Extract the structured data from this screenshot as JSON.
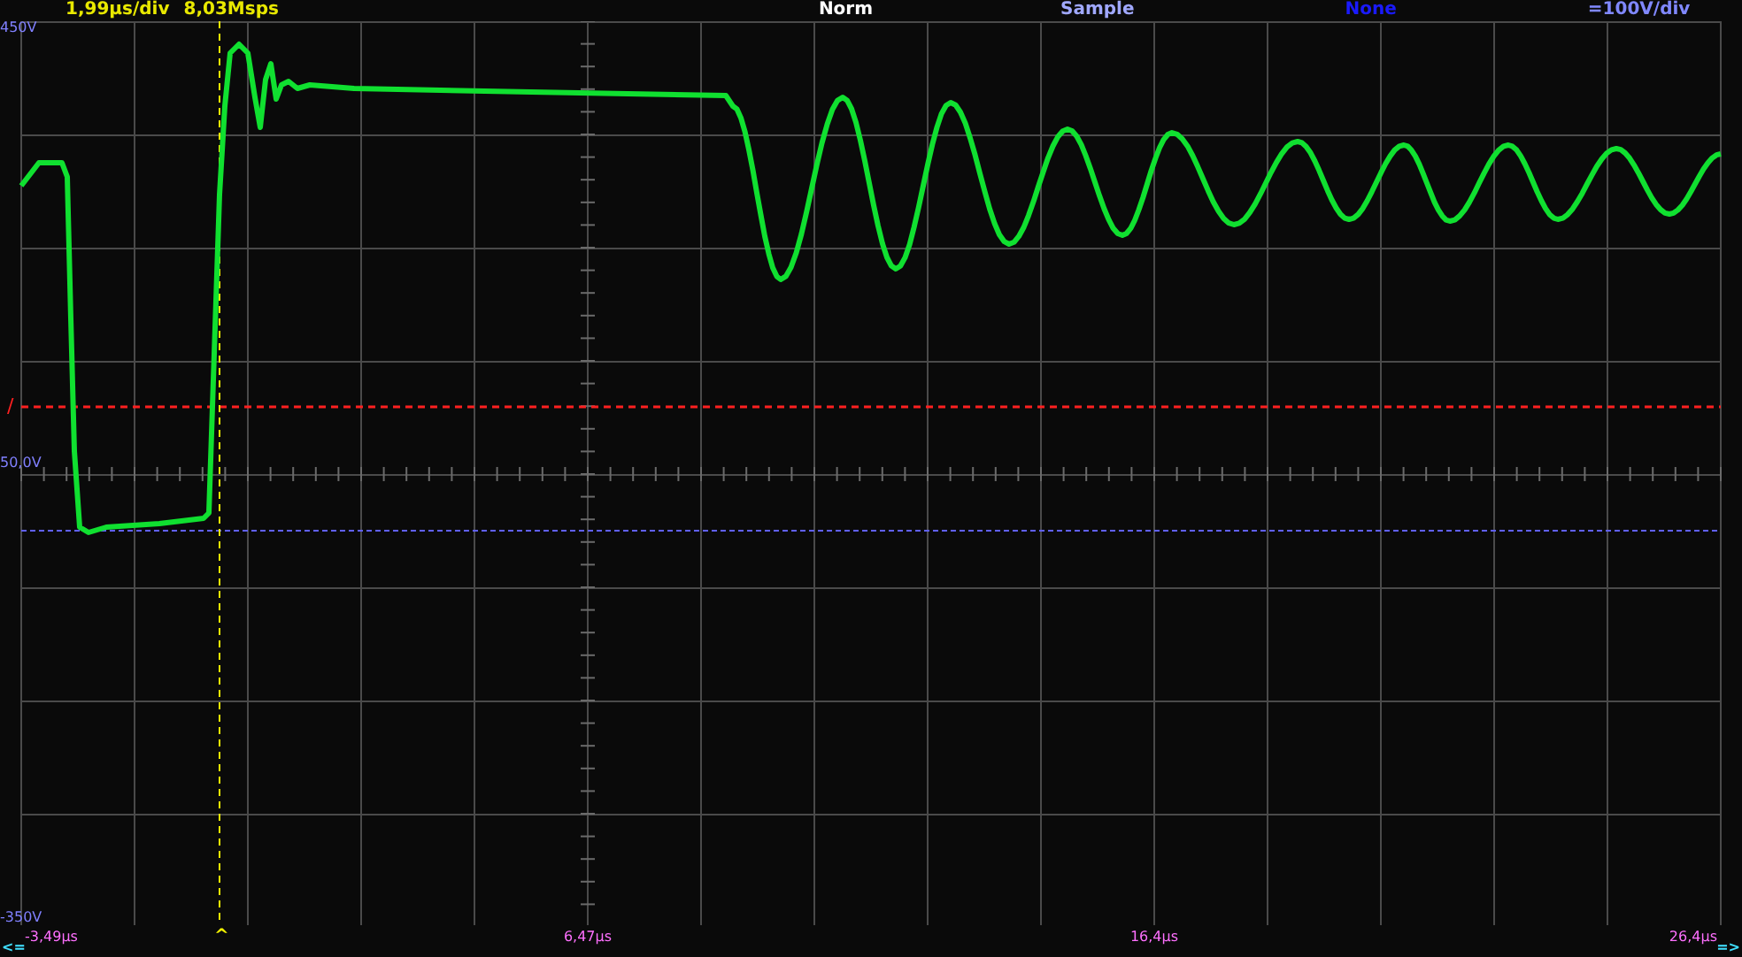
{
  "status_bar": {
    "timebase": "1,99µs/div",
    "sample_rate": "8,03Msps",
    "trigger_mode": "Norm",
    "acquisition": "Sample",
    "math": "None",
    "channel_scale": "=100V/div"
  },
  "plot": {
    "y_top_label": "450V",
    "y_bottom_label": "-350V",
    "channel_level_label": "50,0V",
    "trigger_slope": "/"
  },
  "time_axis": {
    "labels": [
      "-3,49µs",
      "6,47µs",
      "16,4µs",
      "26,4µs"
    ],
    "trigger_marker": "^",
    "scroll_left": "<=",
    "scroll_right": "=>"
  }
}
